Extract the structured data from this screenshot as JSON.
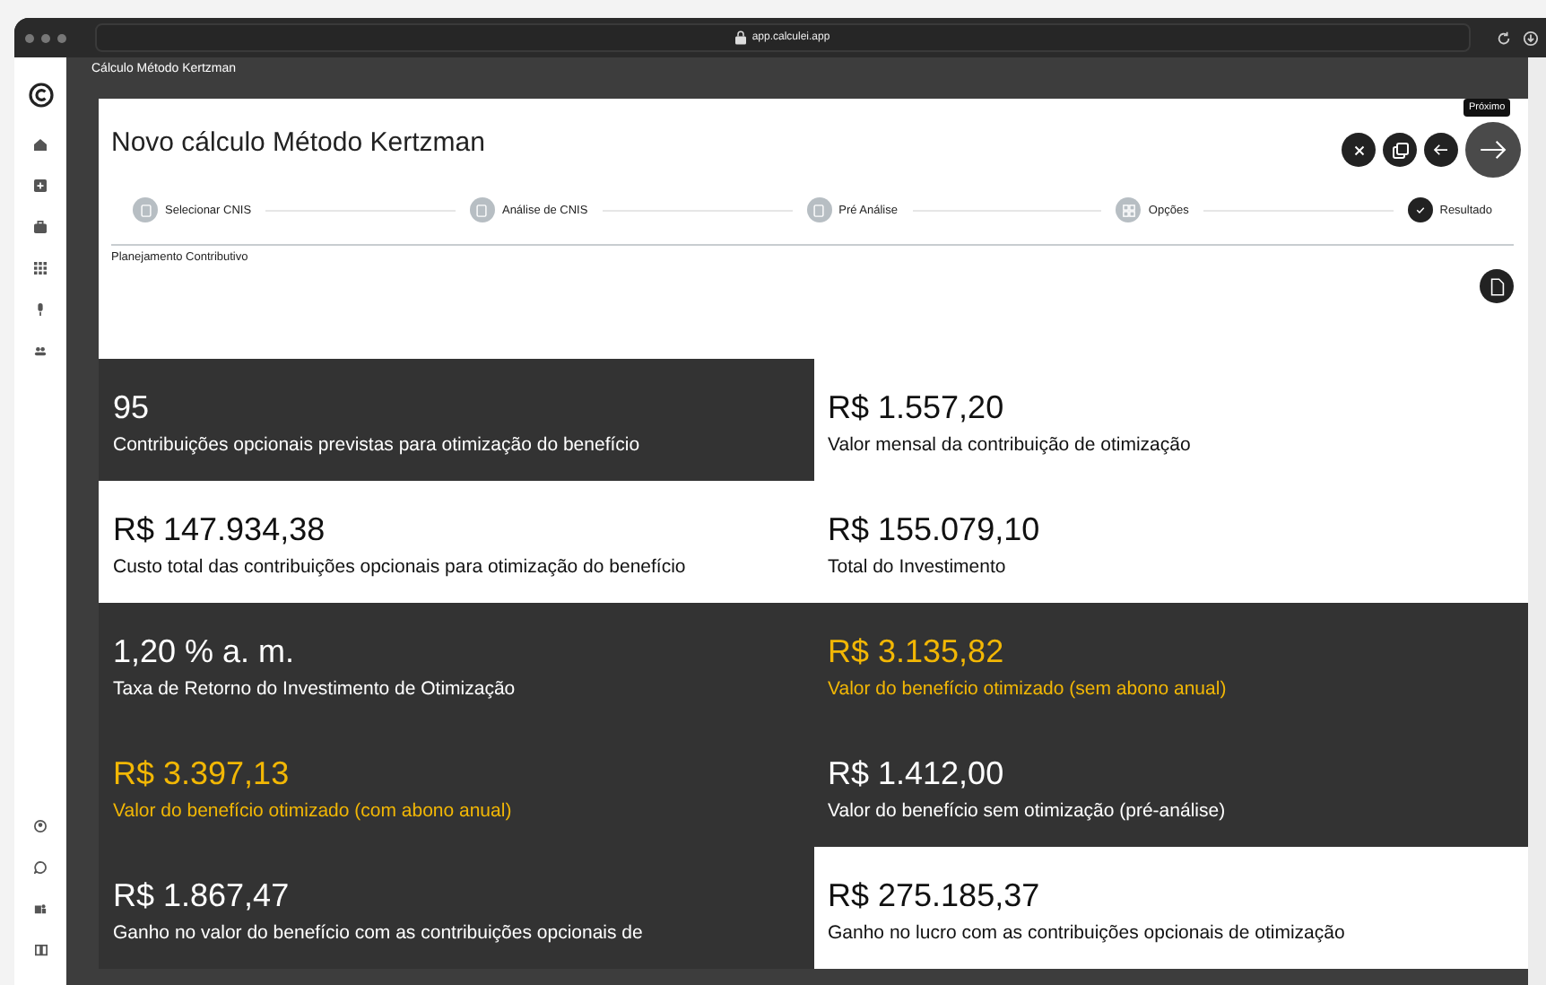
{
  "browser": {
    "url": "app.calculei.app"
  },
  "header": {
    "title": "Cálculo Método Kertzman"
  },
  "page": {
    "title": "Novo cálculo Método Kertzman",
    "tooltip": "Próximo"
  },
  "steps": [
    {
      "label": "Selecionar CNIS",
      "selected": false
    },
    {
      "label": "Análise de CNIS",
      "selected": false
    },
    {
      "label": "Pré Análise",
      "selected": false
    },
    {
      "label": "Opções",
      "selected": false
    },
    {
      "label": "Resultado",
      "selected": true
    }
  ],
  "section": {
    "title": "Planejamento Contributivo"
  },
  "tiles": [
    {
      "value": "95",
      "label": "Contribuições opcionais previstas para otimização do benefício",
      "dark": true,
      "highlight": false
    },
    {
      "value": "R$ 1.557,20",
      "label": "Valor mensal da contribuição de otimização",
      "dark": false,
      "highlight": false
    },
    {
      "value": "R$ 147.934,38",
      "label": "Custo total das contribuições opcionais para otimização do benefício",
      "dark": false,
      "highlight": false
    },
    {
      "value": "R$ 155.079,10",
      "label": "Total do Investimento",
      "dark": false,
      "highlight": false
    },
    {
      "value": "1,20 % a. m.",
      "label": "Taxa de Retorno do Investimento de Otimização",
      "dark": true,
      "highlight": false
    },
    {
      "value": "R$ 3.135,82",
      "label": "Valor do benefício otimizado (sem abono anual)",
      "dark": true,
      "highlight": true
    },
    {
      "value": "R$ 3.397,13",
      "label": "Valor do benefício otimizado (com abono anual)",
      "dark": true,
      "highlight": true
    },
    {
      "value": "R$ 1.412,00",
      "label": "Valor do benefício sem otimização (pré-análise)",
      "dark": true,
      "highlight": false
    },
    {
      "value": "R$ 1.867,47",
      "label": "Ganho no valor do benefício com as contribuições opcionais de",
      "dark": true,
      "highlight": false
    },
    {
      "value": "R$ 275.185,37",
      "label": "Ganho no lucro com as contribuições opcionais de otimização",
      "dark": false,
      "highlight": false
    }
  ]
}
